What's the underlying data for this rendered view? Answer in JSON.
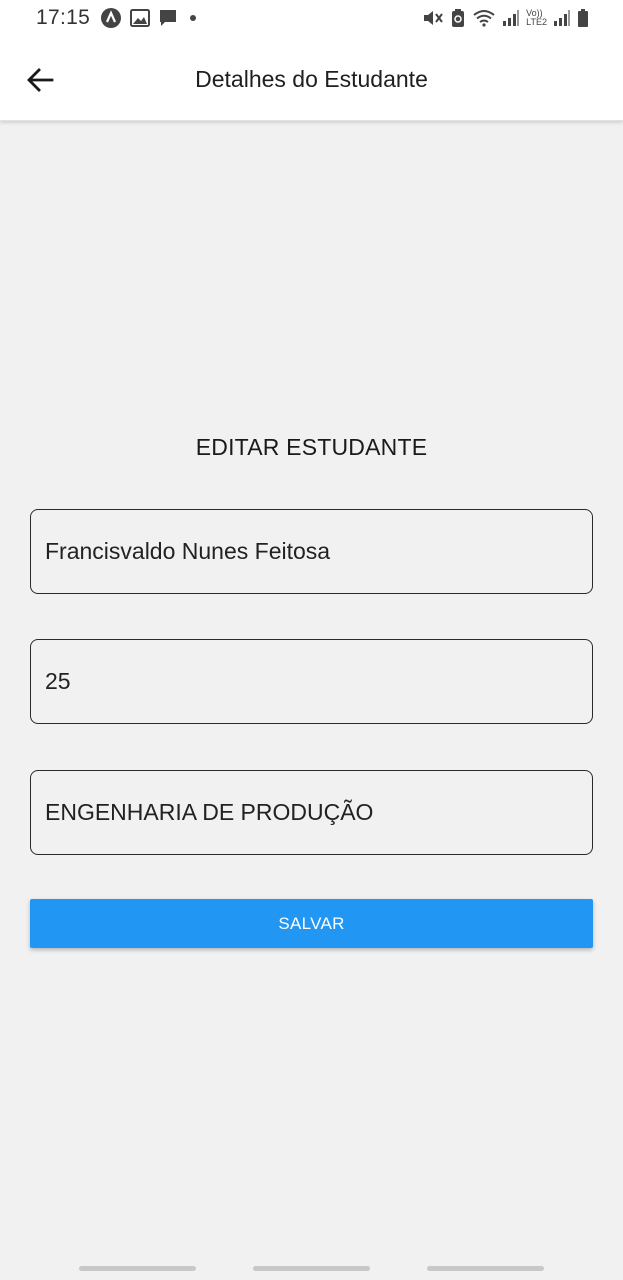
{
  "status_bar": {
    "time": "17:15",
    "left_icons": [
      "app-notification-icon",
      "image-icon",
      "message-icon",
      "dot-icon"
    ],
    "right_icons": [
      "mute-icon",
      "battery-saver-icon",
      "wifi-icon",
      "signal-icon",
      "volte-lte2-icon",
      "signal-icon",
      "battery-icon"
    ],
    "volte_label": "Vo))",
    "lte_label": "LTE2"
  },
  "app_bar": {
    "title": "Detalhes do Estudante"
  },
  "form": {
    "heading": "EDITAR ESTUDANTE",
    "name_value": "Francisvaldo Nunes Feitosa",
    "age_value": "25",
    "course_value": "ENGENHARIA DE PRODUÇÃO",
    "save_label": "SALVAR"
  },
  "colors": {
    "accent": "#2196f3",
    "background": "#f1f1f1",
    "app_bar": "#ffffff"
  }
}
